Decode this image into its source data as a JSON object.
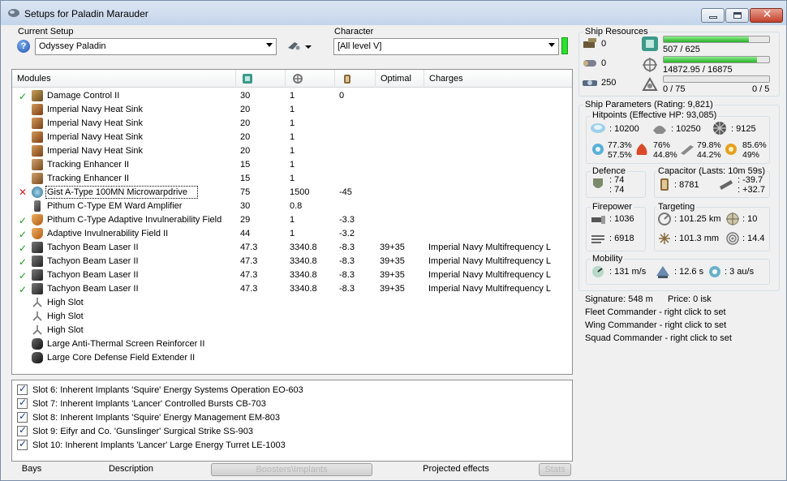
{
  "window": {
    "title": "Setups for Paladin Marauder",
    "min_glyph": "_",
    "close_glyph": "✕"
  },
  "setup": {
    "label": "Current Setup",
    "value": "Odyssey Paladin",
    "help_glyph": "?"
  },
  "character": {
    "label": "Character",
    "value": "[All level V]",
    "status_color": "#2ce02c"
  },
  "modules": {
    "headers": {
      "name": "Modules",
      "cpu_icon": "cpu-icon",
      "pg_icon": "powergrid-icon",
      "cap_icon": "capacitor-icon",
      "optimal": "Optimal",
      "charges": "Charges"
    },
    "ok_glyph": "✓",
    "bad_glyph": "✕",
    "rows": [
      {
        "status": "ok",
        "icon": "damage-control-icon",
        "name": "Damage Control II",
        "cpu": "30",
        "pg": "1",
        "cap": "0",
        "optimal": "",
        "charge": ""
      },
      {
        "status": "",
        "icon": "heat-sink-icon",
        "name": "Imperial Navy Heat Sink",
        "cpu": "20",
        "pg": "1",
        "cap": "",
        "optimal": "",
        "charge": ""
      },
      {
        "status": "",
        "icon": "heat-sink-icon",
        "name": "Imperial Navy Heat Sink",
        "cpu": "20",
        "pg": "1",
        "cap": "",
        "optimal": "",
        "charge": ""
      },
      {
        "status": "",
        "icon": "heat-sink-icon",
        "name": "Imperial Navy Heat Sink",
        "cpu": "20",
        "pg": "1",
        "cap": "",
        "optimal": "",
        "charge": ""
      },
      {
        "status": "",
        "icon": "heat-sink-icon",
        "name": "Imperial Navy Heat Sink",
        "cpu": "20",
        "pg": "1",
        "cap": "",
        "optimal": "",
        "charge": ""
      },
      {
        "status": "",
        "icon": "tracking-enhancer-icon",
        "name": "Tracking Enhancer II",
        "cpu": "15",
        "pg": "1",
        "cap": "",
        "optimal": "",
        "charge": ""
      },
      {
        "status": "",
        "icon": "tracking-enhancer-icon",
        "name": "Tracking Enhancer II",
        "cpu": "15",
        "pg": "1",
        "cap": "",
        "optimal": "",
        "charge": ""
      },
      {
        "status": "bad",
        "icon": "microwarpdrive-icon",
        "name": "Gist A-Type 100MN Microwarpdrive",
        "cpu": "75",
        "pg": "1500",
        "cap": "-45",
        "optimal": "",
        "charge": "",
        "selected": true
      },
      {
        "status": "",
        "icon": "ward-amplifier-icon",
        "name": "Pithum C-Type EM Ward Amplifier",
        "cpu": "30",
        "pg": "0.8",
        "cap": "",
        "optimal": "",
        "charge": ""
      },
      {
        "status": "ok",
        "icon": "invulnerability-field-icon",
        "name": "Pithum C-Type Adaptive Invulnerability Field",
        "cpu": "29",
        "pg": "1",
        "cap": "-3.3",
        "optimal": "",
        "charge": ""
      },
      {
        "status": "ok",
        "icon": "invulnerability-field-icon",
        "name": "Adaptive Invulnerability Field II",
        "cpu": "44",
        "pg": "1",
        "cap": "-3.2",
        "optimal": "",
        "charge": ""
      },
      {
        "status": "ok",
        "icon": "beam-laser-icon",
        "name": "Tachyon Beam Laser II",
        "cpu": "47.3",
        "pg": "3340.8",
        "cap": "-8.3",
        "optimal": "39+35",
        "charge": "Imperial Navy Multifrequency L"
      },
      {
        "status": "ok",
        "icon": "beam-laser-icon",
        "name": "Tachyon Beam Laser II",
        "cpu": "47.3",
        "pg": "3340.8",
        "cap": "-8.3",
        "optimal": "39+35",
        "charge": "Imperial Navy Multifrequency L"
      },
      {
        "status": "ok",
        "icon": "beam-laser-icon",
        "name": "Tachyon Beam Laser II",
        "cpu": "47.3",
        "pg": "3340.8",
        "cap": "-8.3",
        "optimal": "39+35",
        "charge": "Imperial Navy Multifrequency L"
      },
      {
        "status": "ok",
        "icon": "beam-laser-icon",
        "name": "Tachyon Beam Laser II",
        "cpu": "47.3",
        "pg": "3340.8",
        "cap": "-8.3",
        "optimal": "39+35",
        "charge": "Imperial Navy Multifrequency L"
      },
      {
        "status": "",
        "icon": "high-slot-icon",
        "name": "High Slot",
        "cpu": "",
        "pg": "",
        "cap": "",
        "optimal": "",
        "charge": ""
      },
      {
        "status": "",
        "icon": "high-slot-icon",
        "name": "High Slot",
        "cpu": "",
        "pg": "",
        "cap": "",
        "optimal": "",
        "charge": ""
      },
      {
        "status": "",
        "icon": "high-slot-icon",
        "name": "High Slot",
        "cpu": "",
        "pg": "",
        "cap": "",
        "optimal": "",
        "charge": ""
      },
      {
        "status": "",
        "icon": "rig-icon",
        "name": "Large Anti-Thermal Screen Reinforcer II",
        "cpu": "",
        "pg": "",
        "cap": "",
        "optimal": "",
        "charge": ""
      },
      {
        "status": "",
        "icon": "rig-icon",
        "name": "Large Core Defense Field Extender II",
        "cpu": "",
        "pg": "",
        "cap": "",
        "optimal": "",
        "charge": ""
      }
    ]
  },
  "implants": [
    "Slot 6: Inherent Implants 'Squire' Energy Systems Operation EO-603",
    "Slot 7: Inherent Implants 'Lancer' Controlled Bursts CB-703",
    "Slot 8: Inherent Implants 'Squire' Energy Management EM-803",
    "Slot 9: Eifyr and Co. 'Gunslinger' Surgical Strike SS-903",
    "Slot 10: Inherent Implants 'Lancer' Large Energy Turret LE-1003"
  ],
  "tabs": {
    "bays": "Bays",
    "description": "Description",
    "boosters": "Boosters\\Implants",
    "projected": "Projected effects",
    "stats": "Stats"
  },
  "resources": {
    "title": "Ship Resources",
    "turret_hardpoints": "0",
    "launcher_hardpoints": "0",
    "drone_bay": "250",
    "cpu": "507 / 625",
    "cpu_fraction": 0.811,
    "powergrid": "14872.95 / 16875",
    "powergrid_fraction": 0.881,
    "calibration": "0 / 75",
    "drones": "0 / 5",
    "calibration_fraction": 0
  },
  "parameters": {
    "title": "Ship Parameters (Rating: 9,821)",
    "hitpoints_title": "Hitpoints (Effective HP: 93,085)",
    "shield_hp": ": 10200",
    "armor_hp": ": 10250",
    "structure_hp": ": 9125",
    "resists": {
      "em": [
        "77.3%",
        "57.5%"
      ],
      "thermal": [
        "76%",
        "44.8%"
      ],
      "kinetic": [
        "79.8%",
        "44.2%"
      ],
      "explosive": [
        "85.6%",
        "49%"
      ]
    },
    "defence_title": "Defence",
    "defence_top": ": 74",
    "defence_bottom": ": 74",
    "capacitor_title": "Capacitor (Lasts: 10m 59s)",
    "capacitor_amount": ": 8781",
    "capacitor_top": ": -39.7",
    "capacitor_bottom": ": +32.7",
    "firepower_title": "Firepower",
    "firepower_top": ": 1036",
    "firepower_bottom": ": 6918",
    "targeting_title": "Targeting",
    "targeting_range": ": 101.25 km",
    "targeting_targets": ": 10",
    "targeting_scan": ": 101.3 mm",
    "targeting_sensor": ": 14.4",
    "mobility_title": "Mobility",
    "velocity": ": 131 m/s",
    "align": ": 12.6 s",
    "warp": ": 3 au/s"
  },
  "info": {
    "signature": "Signature: 548 m",
    "price": "Price: 0 isk",
    "fleet": "Fleet Commander - right click to set",
    "wing": "Wing Commander - right click to set",
    "squad": "Squad Commander - right click to set"
  }
}
